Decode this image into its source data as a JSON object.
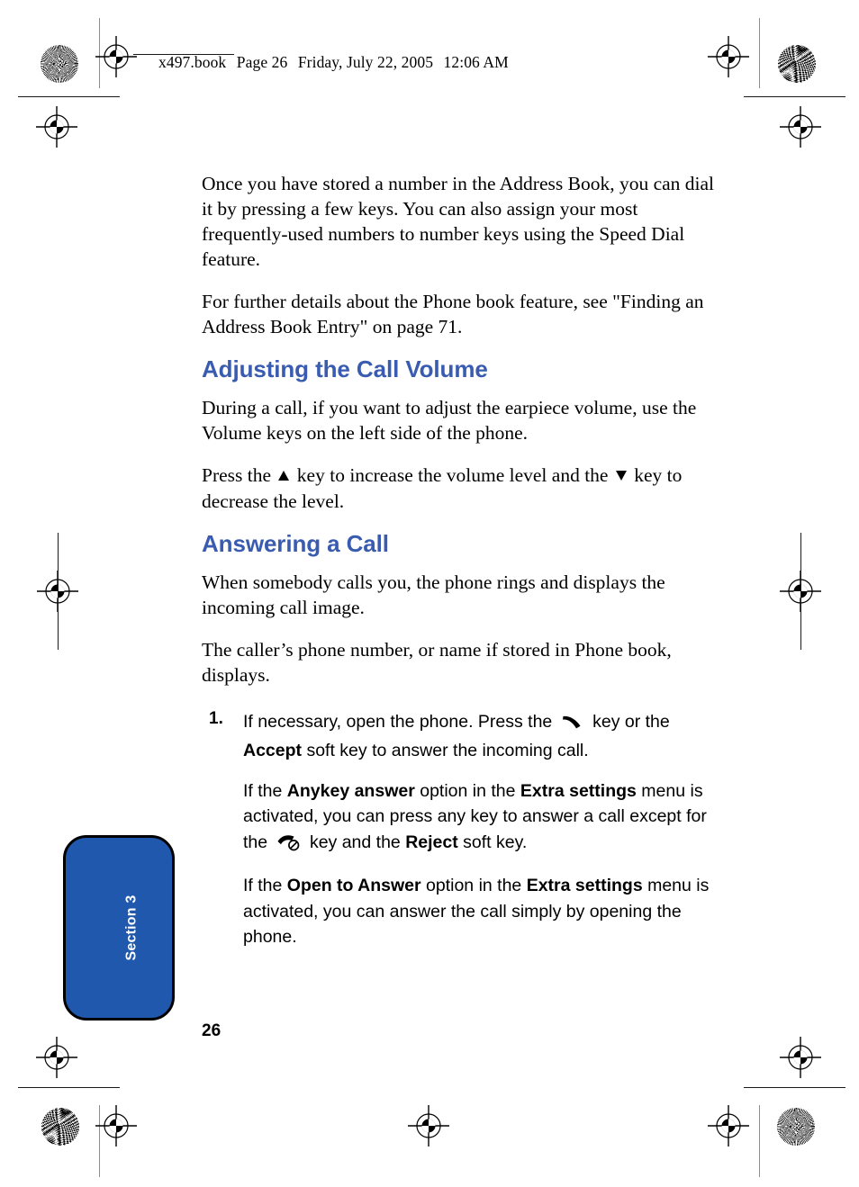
{
  "header": {
    "file_slug": "x497.book",
    "page_label": "Page 26",
    "date_label": "Friday, July 22, 2005",
    "time_label": "12:06 AM"
  },
  "section_tab": {
    "label": "Section 3",
    "color": "#1f58ad"
  },
  "theme": {
    "heading_blue": "#3a5cb0",
    "tab_blue": "#1f58ad",
    "text_black": "#000000"
  },
  "content": {
    "intro_paragraph": "Once you have stored a number in the Address Book, you can dial it by pressing a few keys. You can also assign your most frequently-used numbers to number keys using the Speed Dial feature.",
    "cross_reference_paragraph": "For further details about the Phone book feature, see \"Finding an Address Book Entry\" on page 71.",
    "heading_volume": "Adjusting the Call Volume",
    "volume_paragraph": "During a call, if you want to adjust the earpiece volume, use the Volume keys on the left side of the phone.",
    "volume_keys_part1": "Press the",
    "volume_keys_part2": "key to increase the volume level and the",
    "volume_keys_part3": "key to decrease the level.",
    "heading_answering": "Answering a Call",
    "answering_paragraph": "When somebody calls you, the phone rings and displays the incoming call image.",
    "caller_paragraph": "The caller’s phone number, or name if stored in Phone book, displays.",
    "step1": {
      "number": "1.",
      "text_a": "If necessary, open the phone. Press the",
      "text_b": "key or the",
      "bold_accept": "Accept",
      "text_c": "soft key to answer the incoming call."
    },
    "anykey": {
      "text_a": "If the",
      "bold_anykey": "Anykey answer",
      "text_b": "option in the",
      "bold_extra1": "Extra settings",
      "text_c": "menu is activated, you can press any key to answer a call except for the",
      "text_d": "key and the",
      "bold_reject": "Reject",
      "text_e": "soft key."
    },
    "opentoanswer": {
      "text_a": "If the",
      "bold_open": "Open to Answer",
      "text_b": "option in the",
      "bold_extra2": "Extra settings",
      "text_c": "menu is activated, you can answer the call simply by opening the phone."
    }
  },
  "folio": {
    "page_number": "26"
  },
  "icons": {
    "volume_up": "triangle-up-icon",
    "volume_down": "triangle-down-icon",
    "send_key": "phone-send-key-icon",
    "end_key": "phone-end-key-icon"
  }
}
